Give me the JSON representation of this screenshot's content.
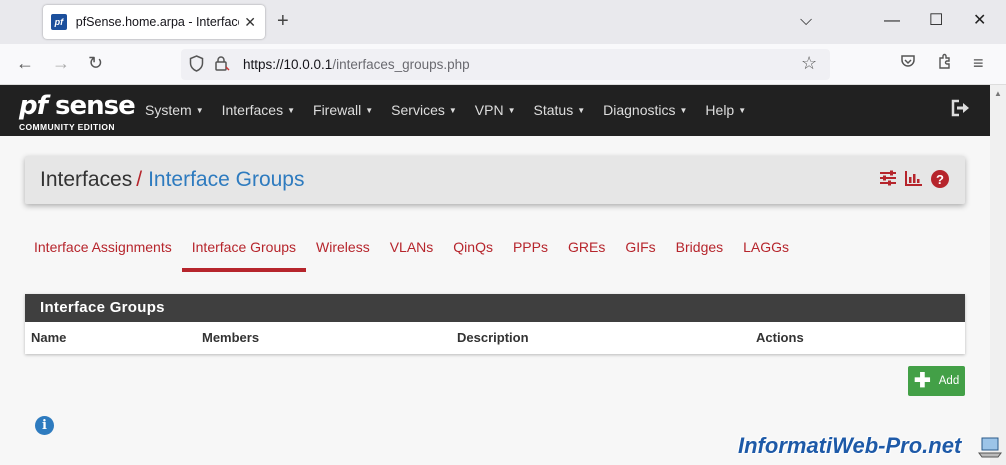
{
  "browser": {
    "tab_title": "pfSense.home.arpa - Interfaces: Interface Groups",
    "tab_close": "✕",
    "new_tab": "+",
    "url_host": "https://10.0.0.1",
    "url_path": "/interfaces_groups.php",
    "icons": [
      "back-icon",
      "forward-icon",
      "reload-icon",
      "shield-icon",
      "lock-icon",
      "star-icon",
      "pocket-icon",
      "extensions-icon",
      "menu-icon"
    ]
  },
  "header": {
    "logo_pf": "pf",
    "logo_sense": "sense",
    "logo_edition": "COMMUNITY EDITION",
    "menu": [
      "System",
      "Interfaces",
      "Firewall",
      "Services",
      "VPN",
      "Status",
      "Diagnostics",
      "Help"
    ]
  },
  "breadcrumb": {
    "section": "Interfaces",
    "separator": "/",
    "page": "Interface Groups"
  },
  "tabs": {
    "items": [
      "Interface Assignments",
      "Interface Groups",
      "Wireless",
      "VLANs",
      "QinQs",
      "PPPs",
      "GREs",
      "GIFs",
      "Bridges",
      "LAGGs"
    ],
    "active": "Interface Groups"
  },
  "panel": {
    "title": "Interface Groups",
    "columns": [
      "Name",
      "Members",
      "Description",
      "Actions"
    ],
    "rows": []
  },
  "actions": {
    "add_label": "Add"
  },
  "colors": {
    "accent_red": "#b6252c",
    "link_blue": "#2e7bbf",
    "header_dark": "#212121",
    "add_green": "#43a047"
  },
  "watermark": "InformatiWeb-Pro.net"
}
